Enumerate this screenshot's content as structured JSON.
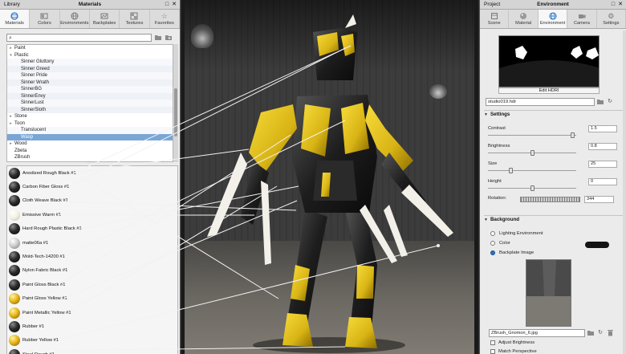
{
  "library": {
    "panel_left_title": "Library",
    "panel_title": "Materials",
    "window_controls": [
      "□",
      "✕"
    ],
    "tabs": [
      {
        "label": "Materials",
        "icon": "sphere-icon",
        "active": true
      },
      {
        "label": "Colors",
        "icon": "palette-icon",
        "active": false
      },
      {
        "label": "Environments",
        "icon": "globe-icon",
        "active": false
      },
      {
        "label": "Backplates",
        "icon": "backplate-icon",
        "active": false
      },
      {
        "label": "Textures",
        "icon": "texture-icon",
        "active": false
      },
      {
        "label": "Favorites",
        "icon": "star-icon",
        "active": false
      }
    ],
    "search": {
      "value": "",
      "placeholder": ""
    },
    "tree": [
      {
        "label": "Paint",
        "type": "folder",
        "collapsed": true
      },
      {
        "label": "Plastic",
        "type": "folder",
        "collapsed": false
      },
      {
        "label": "Sinner Gluttony",
        "type": "child"
      },
      {
        "label": "Sinner Greed",
        "type": "child"
      },
      {
        "label": "Sinner Pride",
        "type": "child"
      },
      {
        "label": "Sinner Wrath",
        "type": "child"
      },
      {
        "label": "SinnerBG",
        "type": "child"
      },
      {
        "label": "SinnerEnvy",
        "type": "child"
      },
      {
        "label": "SinnerLust",
        "type": "child"
      },
      {
        "label": "SinnerSloth",
        "type": "child"
      },
      {
        "label": "Stone",
        "type": "folder",
        "collapsed": true
      },
      {
        "label": "Toon",
        "type": "folder",
        "collapsed": true
      },
      {
        "label": "Translucent",
        "type": "child"
      },
      {
        "label": "Wasp",
        "type": "child",
        "selected": true
      },
      {
        "label": "Wood",
        "type": "folder",
        "collapsed": true
      },
      {
        "label": "Zbeta",
        "type": "leaf"
      },
      {
        "label": "ZBrush",
        "type": "leaf"
      }
    ],
    "materials": [
      {
        "name": "Anodized Rough Black #1",
        "swatch": "black"
      },
      {
        "name": "Carbon Fiber Gloss #1",
        "swatch": "black"
      },
      {
        "name": "Cloth Weave Black #1",
        "swatch": "black"
      },
      {
        "name": "Emissive Warm #1",
        "swatch": "white"
      },
      {
        "name": "Hard Rough Plastic Black #1",
        "swatch": "black"
      },
      {
        "name": "matte06a #1",
        "swatch": "grey"
      },
      {
        "name": "Mold-Tech-14200 #1",
        "swatch": "black"
      },
      {
        "name": "Nylon Fabric Black #1",
        "swatch": "black"
      },
      {
        "name": "Paint Gloss Black #1",
        "swatch": "black"
      },
      {
        "name": "Paint Gloss Yellow #1",
        "swatch": "yellow"
      },
      {
        "name": "Paint Metallic Yellow #1",
        "swatch": "yellow"
      },
      {
        "name": "Rubber #1",
        "swatch": "black"
      },
      {
        "name": "Rubber Yellow #1",
        "swatch": "yellow"
      },
      {
        "name": "Steel Rough #1",
        "swatch": "black"
      }
    ]
  },
  "environment": {
    "panel_left_title": "Project",
    "panel_title": "Environment",
    "window_controls": [
      "□",
      "✕"
    ],
    "tabs": [
      {
        "label": "Scene",
        "icon": "scene-icon",
        "active": false
      },
      {
        "label": "Material",
        "icon": "material-icon",
        "active": false
      },
      {
        "label": "Environment",
        "icon": "globe-icon",
        "active": true
      },
      {
        "label": "Camera",
        "icon": "camera-icon",
        "active": false
      },
      {
        "label": "Settings",
        "icon": "gear-icon",
        "active": false
      }
    ],
    "edit_hdri_label": "Edit HDRI",
    "hdri_file": "studio019.hdr",
    "settings_header": "Settings",
    "contrast": {
      "label": "Contrast",
      "value": "1.5",
      "fraction": 0.95
    },
    "brightness": {
      "label": "Brightness",
      "value": "0.8",
      "fraction": 0.5
    },
    "size": {
      "label": "Size",
      "value": "25",
      "fraction": 0.25
    },
    "height": {
      "label": "Height",
      "value": "0",
      "fraction": 0.5
    },
    "rotation": {
      "label": "Rotation:",
      "value": "344"
    },
    "background_header": "Background",
    "background_options": [
      {
        "label": "Lighting Environment",
        "selected": false
      },
      {
        "label": "Color",
        "selected": false
      },
      {
        "label": "Backplate Image",
        "selected": true
      }
    ],
    "color_value": "#141414",
    "backplate_file": "ZBrush_Gnomon_6.jpg",
    "adjust_brightness_label": "Adjust Brightness",
    "match_perspective_label": "Match Perspective"
  }
}
